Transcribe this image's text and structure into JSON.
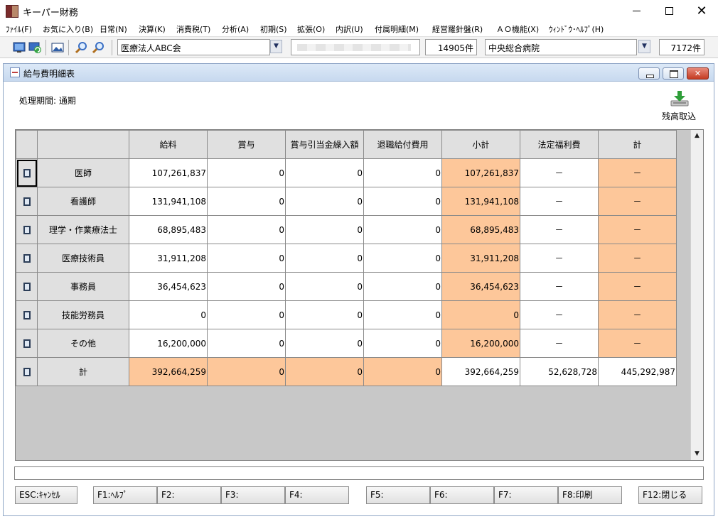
{
  "app": {
    "title": "キーパー財務"
  },
  "menu": [
    "ﾌｧｲﾙ(F)",
    "お気に入り(B)",
    "日常(N)",
    "決算(K)",
    "消費税(T)",
    "分析(A)",
    "初期(S)",
    "拡張(O)",
    "内訳(U)",
    "付属明細(M)",
    "経営羅針盤(R)",
    "ＡＯ機能(X)",
    "ｳｨﾝﾄﾞｳ･ﾍﾙﾌﾟ(H)"
  ],
  "toolbar": {
    "corp_name": "医療法人ABC会",
    "corp_count": "14905件",
    "facility_name": "中央総合病院",
    "facility_count": "7172件"
  },
  "sub_window": {
    "title": "給与費明細表"
  },
  "period_label": "処理期間: 通期",
  "import_button": {
    "label": "残高取込",
    "icon": "download-icon"
  },
  "grid": {
    "headers": [
      "",
      "",
      "給料",
      "賞与",
      "賞与引当金繰入額",
      "退職給付費用",
      "小計",
      "法定福利費",
      "計"
    ],
    "rows": [
      {
        "label": "医師",
        "values": [
          "107,261,837",
          "0",
          "0",
          "0",
          "107,261,837",
          "－",
          "－"
        ]
      },
      {
        "label": "看護師",
        "values": [
          "131,941,108",
          "0",
          "0",
          "0",
          "131,941,108",
          "－",
          "－"
        ]
      },
      {
        "label": "理学・作業療法士",
        "values": [
          "68,895,483",
          "0",
          "0",
          "0",
          "68,895,483",
          "－",
          "－"
        ]
      },
      {
        "label": "医療技術員",
        "values": [
          "31,911,208",
          "0",
          "0",
          "0",
          "31,911,208",
          "－",
          "－"
        ]
      },
      {
        "label": "事務員",
        "values": [
          "36,454,623",
          "0",
          "0",
          "0",
          "36,454,623",
          "－",
          "－"
        ]
      },
      {
        "label": "技能労務員",
        "values": [
          "0",
          "0",
          "0",
          "0",
          "0",
          "－",
          "－"
        ]
      },
      {
        "label": "その他",
        "values": [
          "16,200,000",
          "0",
          "0",
          "0",
          "16,200,000",
          "－",
          "－"
        ]
      },
      {
        "label": "計",
        "values": [
          "392,664,259",
          "0",
          "0",
          "0",
          "392,664,259",
          "52,628,728",
          "445,292,987"
        ]
      }
    ],
    "highlight_color": "#fdc79a"
  },
  "function_keys": [
    "ESC:ｷｬﾝｾﾙ",
    "F1:ﾍﾙﾌﾟ",
    "F2:",
    "F3:",
    "F4:",
    "F5:",
    "F6:",
    "F7:",
    "F8:印刷",
    "F12:閉じる"
  ]
}
